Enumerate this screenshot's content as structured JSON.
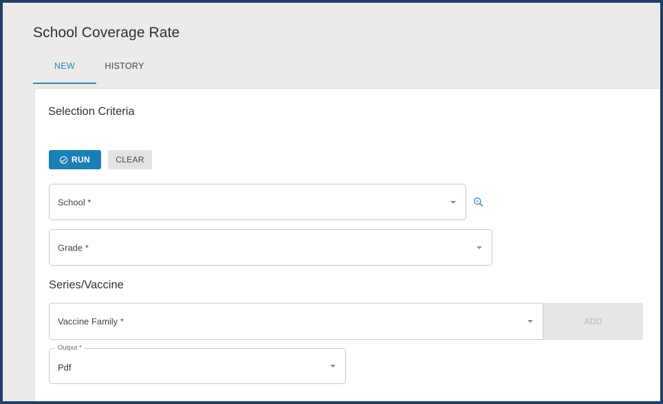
{
  "page": {
    "title": "School Coverage Rate"
  },
  "tabs": [
    {
      "label": "NEW",
      "active": true
    },
    {
      "label": "HISTORY",
      "active": false
    }
  ],
  "criteria": {
    "title": "Selection Criteria",
    "run_label": "RUN",
    "clear_label": "CLEAR",
    "school_label": "School *",
    "grade_label": "Grade *"
  },
  "series": {
    "title": "Series/Vaccine",
    "vaccine_family_label": "Vaccine Family *",
    "add_label": "ADD"
  },
  "output": {
    "label": "Output *",
    "value": "Pdf"
  },
  "icons": {
    "run": "check-circle-icon",
    "school_search": "search-icon",
    "dropdown": "chevron-down-icon"
  },
  "colors": {
    "accent": "#1a7fb5",
    "tab_active": "#2f86b7",
    "frame_border": "#1f3f66",
    "page_background": "#ecebe9",
    "disabled_button": "#e6e6e5"
  }
}
